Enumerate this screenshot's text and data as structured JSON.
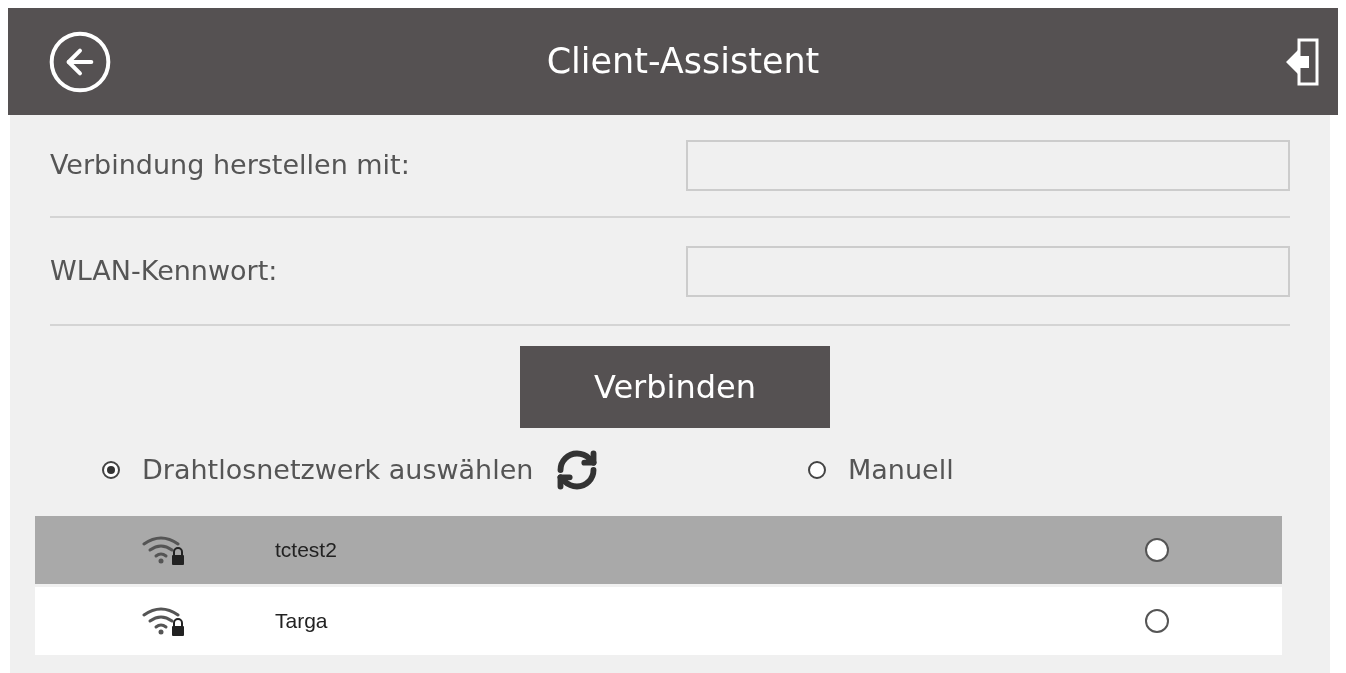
{
  "header": {
    "title": "Client-Assistent"
  },
  "form": {
    "fields": [
      {
        "label": "Verbindung herstellen mit:"
      },
      {
        "label": "WLAN-Kennwort:"
      }
    ],
    "connect_button": "Verbinden"
  },
  "mode_options": [
    {
      "label": "Drahtlosnetzwerk auswählen",
      "selected": true,
      "kind": "with-refresh"
    },
    {
      "label": "Manuell",
      "selected": false,
      "kind": "plain"
    }
  ],
  "networks": [
    {
      "name": "tctest2",
      "selected": true,
      "checked": false
    },
    {
      "name": "Targa",
      "selected": false,
      "checked": false
    }
  ]
}
